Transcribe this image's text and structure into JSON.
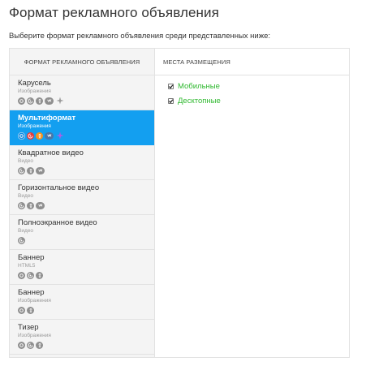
{
  "page": {
    "title": "Формат рекламного объявления",
    "subtitle": "Выберите формат рекламного объявления среди представленных ниже:"
  },
  "table": {
    "formats_header": "Формат рекламного объявления",
    "placements_header": "Места размещения"
  },
  "formats": [
    {
      "title": "Карусель",
      "subtitle": "Изображения",
      "icons": [
        "mail-icon",
        "target-icon",
        "ok-icon",
        "vk-icon",
        "star-icon"
      ],
      "selected": false
    },
    {
      "title": "Мультиформат",
      "subtitle": "Изображения",
      "icons": [
        "mail-icon",
        "target-icon",
        "ok-icon",
        "vk-icon",
        "star-icon"
      ],
      "selected": true
    },
    {
      "title": "Квадратное видео",
      "subtitle": "Видео",
      "icons": [
        "target-icon",
        "ok-icon",
        "vk-icon"
      ],
      "selected": false
    },
    {
      "title": "Горизонтальное видео",
      "subtitle": "Видео",
      "icons": [
        "target-icon",
        "ok-icon",
        "vk-icon"
      ],
      "selected": false
    },
    {
      "title": "Полноэкранное видео",
      "subtitle": "Видео",
      "icons": [
        "target-icon"
      ],
      "selected": false
    },
    {
      "title": "Баннер",
      "subtitle": "HTML5",
      "icons": [
        "mail-icon",
        "target-icon",
        "ok-icon"
      ],
      "selected": false
    },
    {
      "title": "Баннер",
      "subtitle": "Изображения",
      "icons": [
        "mail-icon",
        "ok-icon"
      ],
      "selected": false
    },
    {
      "title": "Тизер",
      "subtitle": "Изображения",
      "icons": [
        "mail-icon",
        "target-icon",
        "ok-icon"
      ],
      "selected": false
    }
  ],
  "placements": [
    {
      "label": "Мобильные",
      "checked": true
    },
    {
      "label": "Десктопные",
      "checked": true
    }
  ],
  "colors": {
    "accent": "#139ff0",
    "placement_text": "#2eb82e",
    "icon_gray": "#8f8f8f"
  }
}
